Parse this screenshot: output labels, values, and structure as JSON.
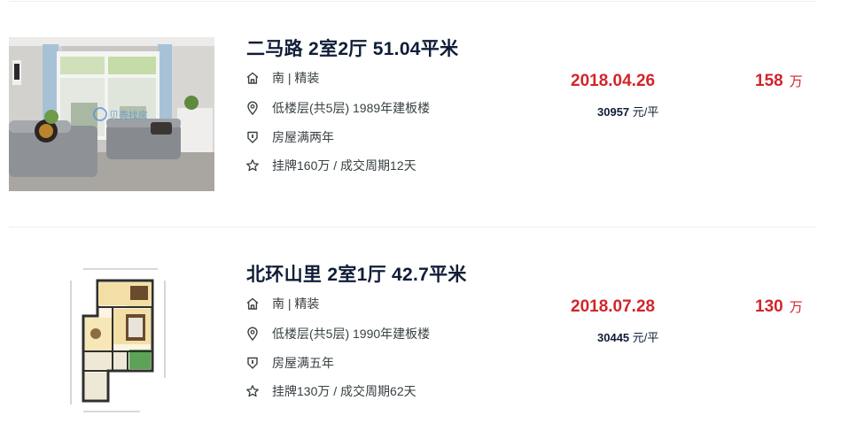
{
  "listings": [
    {
      "title": "二马路 2室2厅 51.04平米",
      "house_info": "南 | 精装",
      "position_info": "低楼层(共5层) 1989年建板楼",
      "deal_house_tag": "房屋满两年",
      "deal_cycle": "挂牌160万 / 成交周期12天",
      "deal_date": "2018.04.26",
      "unit_price_value": "30957",
      "unit_price_unit": "元/平",
      "total_price_value": "158",
      "total_price_unit": "万",
      "photo_watermark": "贝壳找房",
      "photo_kind": "living-room-photo"
    },
    {
      "title": "北环山里 2室1厅 42.7平米",
      "house_info": "南 | 精装",
      "position_info": "低楼层(共5层) 1990年建板楼",
      "deal_house_tag": "房屋满五年",
      "deal_cycle": "挂牌130万 / 成交周期62天",
      "deal_date": "2018.07.28",
      "unit_price_value": "30445",
      "unit_price_unit": "元/平",
      "total_price_value": "130",
      "total_price_unit": "万",
      "photo_kind": "floor-plan-image"
    }
  ],
  "icons": {
    "house_info": "house-icon",
    "position_info": "location-pin-icon",
    "deal_house_tag": "shield-icon",
    "deal_cycle": "star-icon"
  },
  "colors": {
    "price_red": "#d0262b",
    "title_navy": "#101d37",
    "body_text": "#394043"
  }
}
